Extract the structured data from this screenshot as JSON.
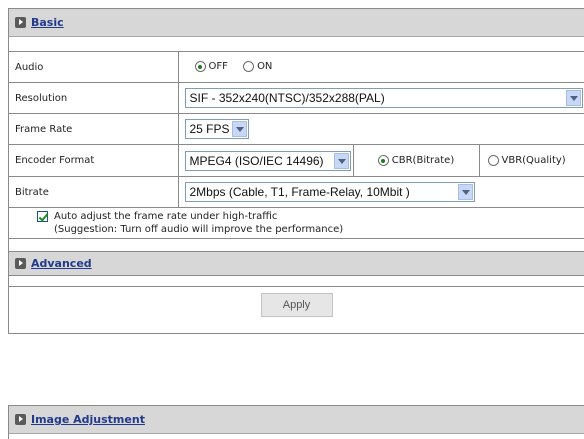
{
  "basic": {
    "title": "Basic",
    "audio": {
      "label": "Audio",
      "off_label": "OFF",
      "on_label": "ON",
      "selected": "OFF"
    },
    "resolution": {
      "label": "Resolution",
      "value": "SIF - 352x240(NTSC)/352x288(PAL)"
    },
    "frame_rate": {
      "label": "Frame Rate",
      "value": "25 FPS"
    },
    "encoder_format": {
      "label": "Encoder Format",
      "value": "MPEG4 (ISO/IEC 14496)",
      "cbr_label": "CBR(Bitrate)",
      "vbr_label": "VBR(Quality)",
      "selected": "CBR"
    },
    "bitrate": {
      "label": "Bitrate",
      "value": "2Mbps (Cable, T1, Frame-Relay, 10Mbit )"
    },
    "auto_adjust": {
      "checked": true,
      "line1": "Auto adjust the frame rate under high-traffic",
      "line2": "(Suggestion: Turn off audio will improve the performance)"
    }
  },
  "advanced": {
    "title": "Advanced"
  },
  "apply_label": "Apply",
  "image_adjustment": {
    "title": "Image Adjustment"
  },
  "colors": {
    "header_bg": "#d7d7d7",
    "link": "#223a8c",
    "check": "#1f8a1f"
  },
  "icons": [
    "arrow-right-icon",
    "radio-icon",
    "checkbox-icon",
    "dropdown-arrow-icon"
  ]
}
